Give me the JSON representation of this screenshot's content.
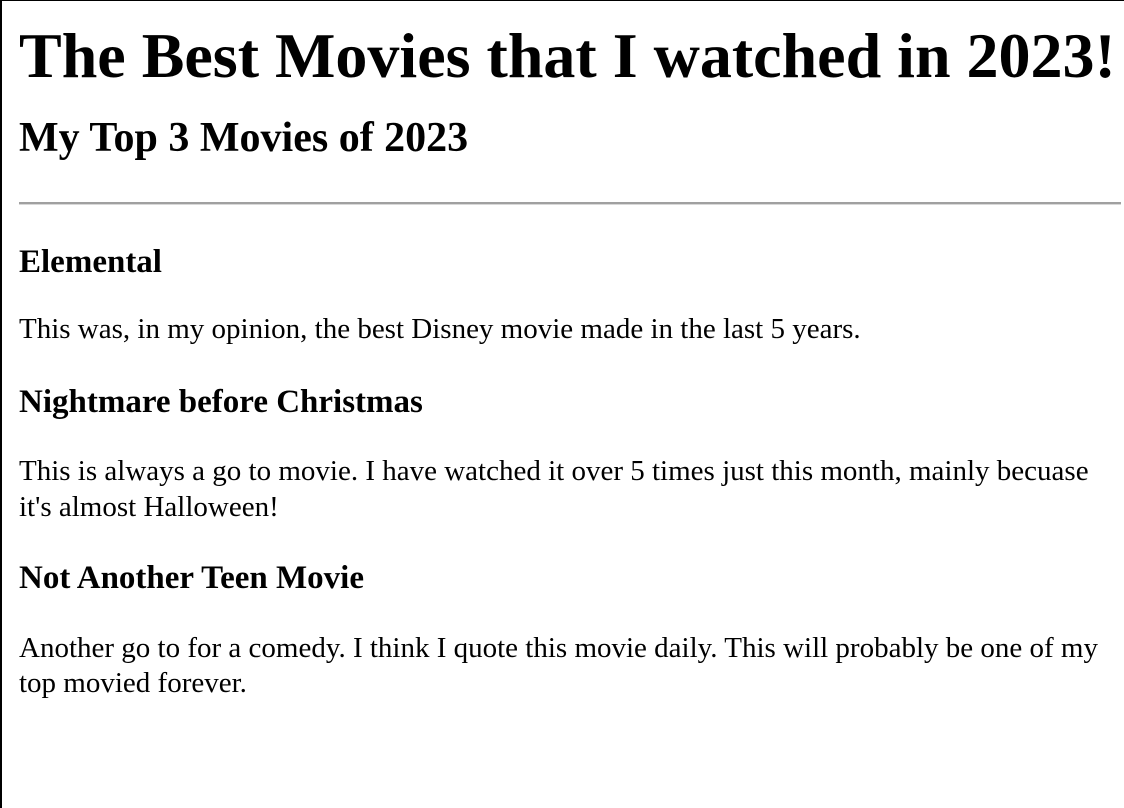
{
  "page": {
    "title": "The Best Movies that I watched in 2023!",
    "subtitle": "My Top 3 Movies of 2023"
  },
  "movies": [
    {
      "name": "Elemental",
      "description": "This was, in my opinion, the best Disney movie made in the last 5 years."
    },
    {
      "name": "Nightmare before Christmas",
      "description": "This is always a go to movie. I have watched it over 5 times just this month, mainly becuase it's almost Halloween!"
    },
    {
      "name": "Not Another Teen Movie",
      "description": "Another go to for a comedy. I think I quote this movie daily. This will probably be one of my top movied forever."
    }
  ]
}
